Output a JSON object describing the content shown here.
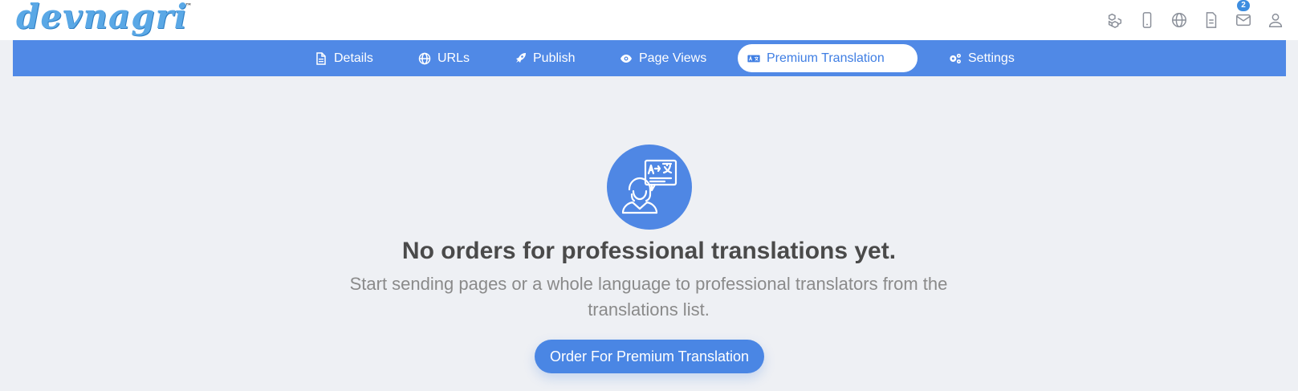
{
  "brand": {
    "logo_text": "devnagri",
    "trademark": "™"
  },
  "header": {
    "icons": [
      {
        "name": "cubes-icon"
      },
      {
        "name": "mobile-icon"
      },
      {
        "name": "globe-icon"
      },
      {
        "name": "document-icon"
      },
      {
        "name": "mail-icon",
        "badge": "2"
      },
      {
        "name": "user-icon"
      }
    ]
  },
  "nav": {
    "tabs": [
      {
        "label": "Details",
        "icon": "file-icon"
      },
      {
        "label": "URLs",
        "icon": "globe-icon"
      },
      {
        "label": "Publish",
        "icon": "rocket-icon"
      },
      {
        "label": "Page Views",
        "icon": "eye-icon"
      },
      {
        "label": "Premium Translation",
        "icon": "language-icon",
        "active": true
      },
      {
        "label": "Settings",
        "icon": "gears-icon"
      }
    ]
  },
  "empty_state": {
    "icon": "translator-icon",
    "headline": "No orders for professional translations yet.",
    "subtext": "Start sending pages or a whole language to professional translators from the translations list.",
    "button_label": "Order For Premium Translation"
  },
  "colors": {
    "accent": "#5089e6",
    "background": "#eef0f4",
    "headline": "#4a4a4a",
    "subtext": "#8a8a8a"
  }
}
